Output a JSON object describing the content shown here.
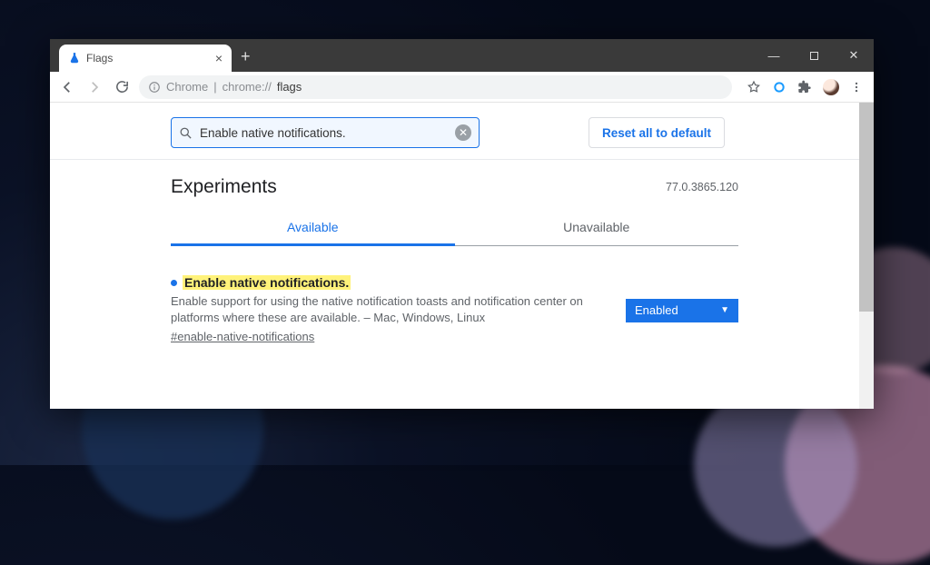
{
  "window": {
    "tab_title": "Flags"
  },
  "toolbar": {
    "omnibox_host": "Chrome",
    "omnibox_sep": " | ",
    "omnibox_prefix": "chrome://",
    "omnibox_path": "flags"
  },
  "search": {
    "value": "Enable native notifications."
  },
  "reset_label": "Reset all to default",
  "page_title": "Experiments",
  "version": "77.0.3865.120",
  "tabs": {
    "available": "Available",
    "unavailable": "Unavailable"
  },
  "flag": {
    "title": "Enable native notifications.",
    "description": "Enable support for using the native notification toasts and notification center on platforms where these are available. – Mac, Windows, Linux",
    "hash": "#enable-native-notifications",
    "state": "Enabled"
  }
}
